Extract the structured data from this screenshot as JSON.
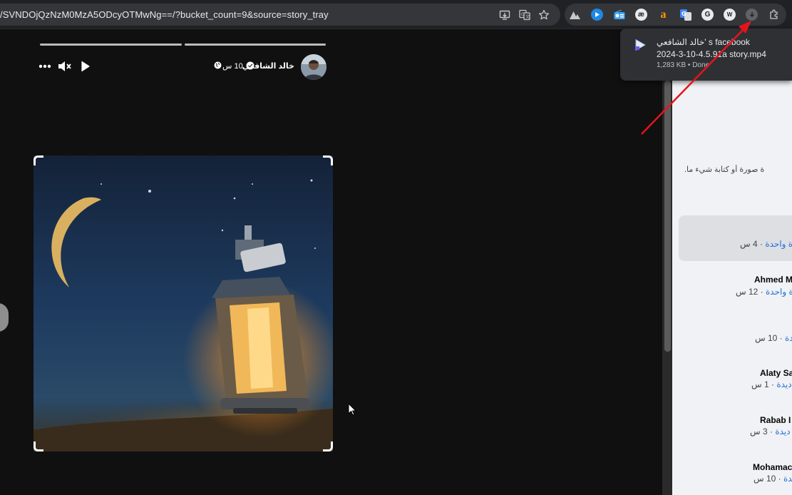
{
  "browser": {
    "url": "/SVNDOjQzNzM0MzA5ODcyOTMwNg==/?bucket_count=9&source=story_tray",
    "download_popup": {
      "title": "خالد الشافعي' s facebook",
      "filename": "2024-3-10-4.5.91a story.mp4",
      "status": "1,283 KB • Done"
    }
  },
  "story": {
    "author_name": "خالد الشافعي",
    "time_ago": "10 س",
    "icons": {
      "more": "more-icon",
      "mute": "mute-icon",
      "play": "play-icon",
      "verified": "verified-badge-icon",
      "privacy": "public-globe-icon"
    },
    "progress": [
      1.0,
      1.0
    ]
  },
  "panel": {
    "hint": "ة صورة أو كتابة شيء ما.",
    "items": [
      {
        "name": "",
        "sub_blue": "دة واحدة",
        "sub_grey": " · 4 س"
      },
      {
        "name": "Ahmed M",
        "sub_blue": "دة واحدة",
        "sub_grey": " · 12 س"
      },
      {
        "name": "",
        "sub_blue": "ديدة",
        "sub_grey": " · 10 س"
      },
      {
        "name": "Alaty Sa",
        "sub_blue": "ديدة",
        "sub_grey": " · 1 س"
      },
      {
        "name": "Rabab I",
        "sub_blue": "ديدة",
        "sub_grey": " · 3 س"
      },
      {
        "name": "Mohamac",
        "sub_blue": "ديدة",
        "sub_grey": " · 10 س"
      }
    ]
  },
  "colors": {
    "accent_blue": "#216fdb",
    "annotation_arrow": "#e3151b",
    "story_bg": "#101010"
  }
}
